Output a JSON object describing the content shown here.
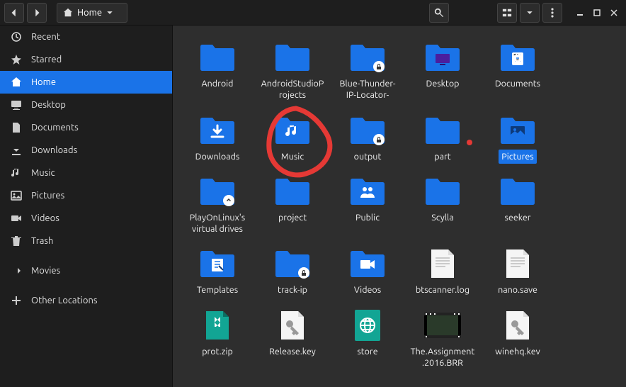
{
  "breadcrumb": {
    "label": "Home"
  },
  "sidebar": {
    "items": [
      {
        "label": "Recent",
        "icon": "clock"
      },
      {
        "label": "Starred",
        "icon": "star"
      },
      {
        "label": "Home",
        "icon": "home",
        "active": true
      },
      {
        "label": "Desktop",
        "icon": "desktop"
      },
      {
        "label": "Documents",
        "icon": "document"
      },
      {
        "label": "Downloads",
        "icon": "download"
      },
      {
        "label": "Music",
        "icon": "music"
      },
      {
        "label": "Pictures",
        "icon": "picture"
      },
      {
        "label": "Videos",
        "icon": "video"
      },
      {
        "label": "Trash",
        "icon": "trash"
      },
      {
        "label": "Movies",
        "icon": "eject"
      },
      {
        "label": "Other Locations",
        "icon": "plus"
      }
    ]
  },
  "files": [
    {
      "name": "Android",
      "type": "folder"
    },
    {
      "name": "AndroidStudioProjects",
      "type": "folder"
    },
    {
      "name": "Blue-Thunder-IP-Locator-",
      "type": "folder",
      "badge": "lock"
    },
    {
      "name": "Desktop",
      "type": "folder-desktop"
    },
    {
      "name": "Documents",
      "type": "folder-documents"
    },
    {
      "name": "Downloads",
      "type": "folder-downloads"
    },
    {
      "name": "Music",
      "type": "folder-music"
    },
    {
      "name": "output",
      "type": "folder",
      "badge": "lock"
    },
    {
      "name": "part",
      "type": "folder"
    },
    {
      "name": "Pictures",
      "type": "folder-pictures",
      "selected": true
    },
    {
      "name": "PlayOnLinux's virtual drives",
      "type": "folder",
      "badge": "link"
    },
    {
      "name": "project",
      "type": "folder"
    },
    {
      "name": "Public",
      "type": "folder-public"
    },
    {
      "name": "Scylla",
      "type": "folder"
    },
    {
      "name": "seeker",
      "type": "folder"
    },
    {
      "name": "Templates",
      "type": "folder-templates"
    },
    {
      "name": "track-ip",
      "type": "folder",
      "badge": "lock"
    },
    {
      "name": "Videos",
      "type": "folder-videos"
    },
    {
      "name": "btscanner.log",
      "type": "text"
    },
    {
      "name": "nano.save",
      "type": "text"
    },
    {
      "name": "prot.zip",
      "type": "zip"
    },
    {
      "name": "Release.key",
      "type": "key"
    },
    {
      "name": "store",
      "type": "web"
    },
    {
      "name": "The.Assignment.2016.BRR",
      "type": "video-thumb"
    },
    {
      "name": "winehq.kev",
      "type": "key"
    }
  ]
}
